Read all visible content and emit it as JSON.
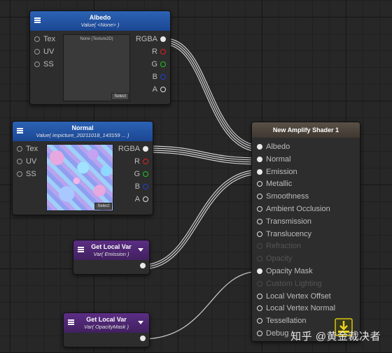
{
  "albedo_node": {
    "title": "Albedo",
    "subtitle": "Value( <None> )",
    "inputs": [
      "Tex",
      "UV",
      "SS"
    ],
    "outputs": [
      "RGBA",
      "R",
      "G",
      "B",
      "A"
    ],
    "texture_label": "None (Texture2D)",
    "select_label": "Select"
  },
  "normal_node": {
    "title": "Normal",
    "subtitle": "Value( impicture_20211018_143159 ... )",
    "inputs": [
      "Tex",
      "UV",
      "SS"
    ],
    "outputs": [
      "RGBA",
      "R",
      "G",
      "B",
      "A"
    ],
    "select_label": "Select"
  },
  "local_var_emission": {
    "title": "Get Local Var",
    "subtitle": "Var( Emission )"
  },
  "local_var_opacity": {
    "title": "Get Local Var",
    "subtitle": "Var( OpacityMask )"
  },
  "master_node": {
    "title": "New Amplify Shader 1",
    "ports": [
      {
        "label": "Albedo",
        "enabled": true,
        "connected": true
      },
      {
        "label": "Normal",
        "enabled": true,
        "connected": true
      },
      {
        "label": "Emission",
        "enabled": true,
        "connected": true
      },
      {
        "label": "Metallic",
        "enabled": true,
        "connected": false
      },
      {
        "label": "Smoothness",
        "enabled": true,
        "connected": false
      },
      {
        "label": "Ambient Occlusion",
        "enabled": true,
        "connected": false
      },
      {
        "label": "Transmission",
        "enabled": true,
        "connected": false
      },
      {
        "label": "Translucency",
        "enabled": true,
        "connected": false
      },
      {
        "label": "Refraction",
        "enabled": false,
        "connected": false
      },
      {
        "label": "Opacity",
        "enabled": false,
        "connected": false
      },
      {
        "label": "Opacity Mask",
        "enabled": true,
        "connected": true
      },
      {
        "label": "Custom Lighting",
        "enabled": false,
        "connected": false
      },
      {
        "label": "Local Vertex Offset",
        "enabled": true,
        "connected": false
      },
      {
        "label": "Local Vertex Normal",
        "enabled": true,
        "connected": false
      },
      {
        "label": "Tessellation",
        "enabled": true,
        "connected": false
      },
      {
        "label": "Debug",
        "enabled": true,
        "connected": false
      }
    ]
  },
  "watermark": "知乎 @黄金裁决者",
  "colors": {
    "header_blue": "#1b4793",
    "header_purple": "#41205f",
    "header_master": "#5a5147",
    "wire": "#d8d8d8"
  }
}
